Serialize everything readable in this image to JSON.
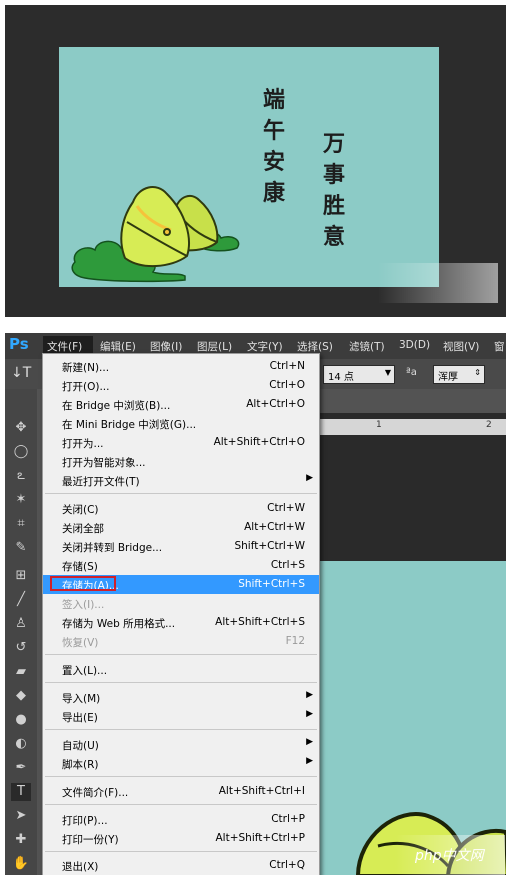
{
  "card": {
    "line1": [
      "端",
      "午",
      "安",
      "康"
    ],
    "line2": [
      "万",
      "事",
      "胜",
      "意"
    ]
  },
  "menubar": {
    "logo": "Ps",
    "items": [
      "文件(F)",
      "编辑(E)",
      "图像(I)",
      "图层(L)",
      "文字(Y)",
      "选择(S)",
      "滤镜(T)",
      "3D(D)",
      "视图(V)",
      "窗"
    ]
  },
  "options": {
    "font_size": "14 点",
    "aa_icon": "ªa",
    "aa_mode": "浑厚"
  },
  "ruler": {
    "marks": [
      "1",
      "2"
    ]
  },
  "file_menu": {
    "items": [
      {
        "label": "新建(N)...",
        "shortcut": "Ctrl+N"
      },
      {
        "label": "打开(O)...",
        "shortcut": "Ctrl+O"
      },
      {
        "label": "在 Bridge 中浏览(B)...",
        "shortcut": "Alt+Ctrl+O"
      },
      {
        "label": "在 Mini Bridge 中浏览(G)...",
        "shortcut": ""
      },
      {
        "label": "打开为...",
        "shortcut": "Alt+Shift+Ctrl+O"
      },
      {
        "label": "打开为智能对象...",
        "shortcut": ""
      },
      {
        "label": "最近打开文件(T)",
        "shortcut": "",
        "submenu": true
      },
      {
        "label": "关闭(C)",
        "shortcut": "Ctrl+W"
      },
      {
        "label": "关闭全部",
        "shortcut": "Alt+Ctrl+W"
      },
      {
        "label": "关闭并转到 Bridge...",
        "shortcut": "Shift+Ctrl+W"
      },
      {
        "label": "存储(S)",
        "shortcut": "Ctrl+S"
      },
      {
        "label": "存储为(A)...",
        "shortcut": "Shift+Ctrl+S",
        "highlighted": true
      },
      {
        "label": "签入(I)...",
        "shortcut": "",
        "disabled": true
      },
      {
        "label": "存储为 Web 所用格式...",
        "shortcut": "Alt+Shift+Ctrl+S"
      },
      {
        "label": "恢复(V)",
        "shortcut": "F12",
        "disabled": true
      },
      {
        "label": "置入(L)...",
        "shortcut": ""
      },
      {
        "label": "导入(M)",
        "shortcut": "",
        "submenu": true
      },
      {
        "label": "导出(E)",
        "shortcut": "",
        "submenu": true
      },
      {
        "label": "自动(U)",
        "shortcut": "",
        "submenu": true
      },
      {
        "label": "脚本(R)",
        "shortcut": "",
        "submenu": true
      },
      {
        "label": "文件简介(F)...",
        "shortcut": "Alt+Shift+Ctrl+I"
      },
      {
        "label": "打印(P)...",
        "shortcut": "Ctrl+P"
      },
      {
        "label": "打印一份(Y)",
        "shortcut": "Alt+Shift+Ctrl+P"
      },
      {
        "label": "退出(X)",
        "shortcut": "Ctrl+Q"
      }
    ]
  },
  "watermark": "php中文网",
  "colors": {
    "card_bg": "#8ccbc6",
    "highlight": "#3399ff",
    "red_box": "#d0202a"
  }
}
